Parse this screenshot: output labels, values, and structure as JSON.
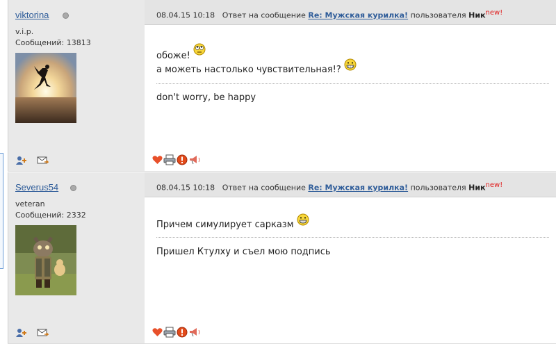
{
  "posts": [
    {
      "author": {
        "username": "viktorina",
        "rank": "v.i.p.",
        "messages_label": "Сообщений: 13813"
      },
      "header": {
        "datetime": "08.04.15 10:18",
        "reply_prefix": "Ответ на сообщение",
        "thread_link": "Re: Мужская курилка!",
        "user_prefix": "пользователя",
        "user": "Ник",
        "new_badge": "new!"
      },
      "body": {
        "line1": "обоже!",
        "line2": "а можеть настолько чувствительная!?",
        "signature": "don't worry, be happy"
      }
    },
    {
      "author": {
        "username": "Severus54",
        "rank": "veteran",
        "messages_label": "Сообщений: 2332"
      },
      "header": {
        "datetime": "08.04.15 10:18",
        "reply_prefix": "Ответ на сообщение",
        "thread_link": "Re: Мужская курилка!",
        "user_prefix": "пользователя",
        "user": "Ник",
        "new_badge": "new!"
      },
      "body": {
        "line1": "Причем симулирует сарказм",
        "signature": "Пришел Ктулху и съел мою подпись"
      }
    }
  ],
  "icons": {
    "author": [
      "add-friend-icon",
      "send-message-icon"
    ],
    "post": [
      "like-heart-icon",
      "print-icon",
      "report-icon",
      "megaphone-icon"
    ],
    "smileys": [
      "rolling-eyes-smiley-icon",
      "grin-smiley-icon"
    ]
  },
  "colors": {
    "link": "#2e5c99",
    "new_badge": "#e02020",
    "header_bg": "#e4e4e4",
    "author_bg": "#e9e9e9"
  }
}
